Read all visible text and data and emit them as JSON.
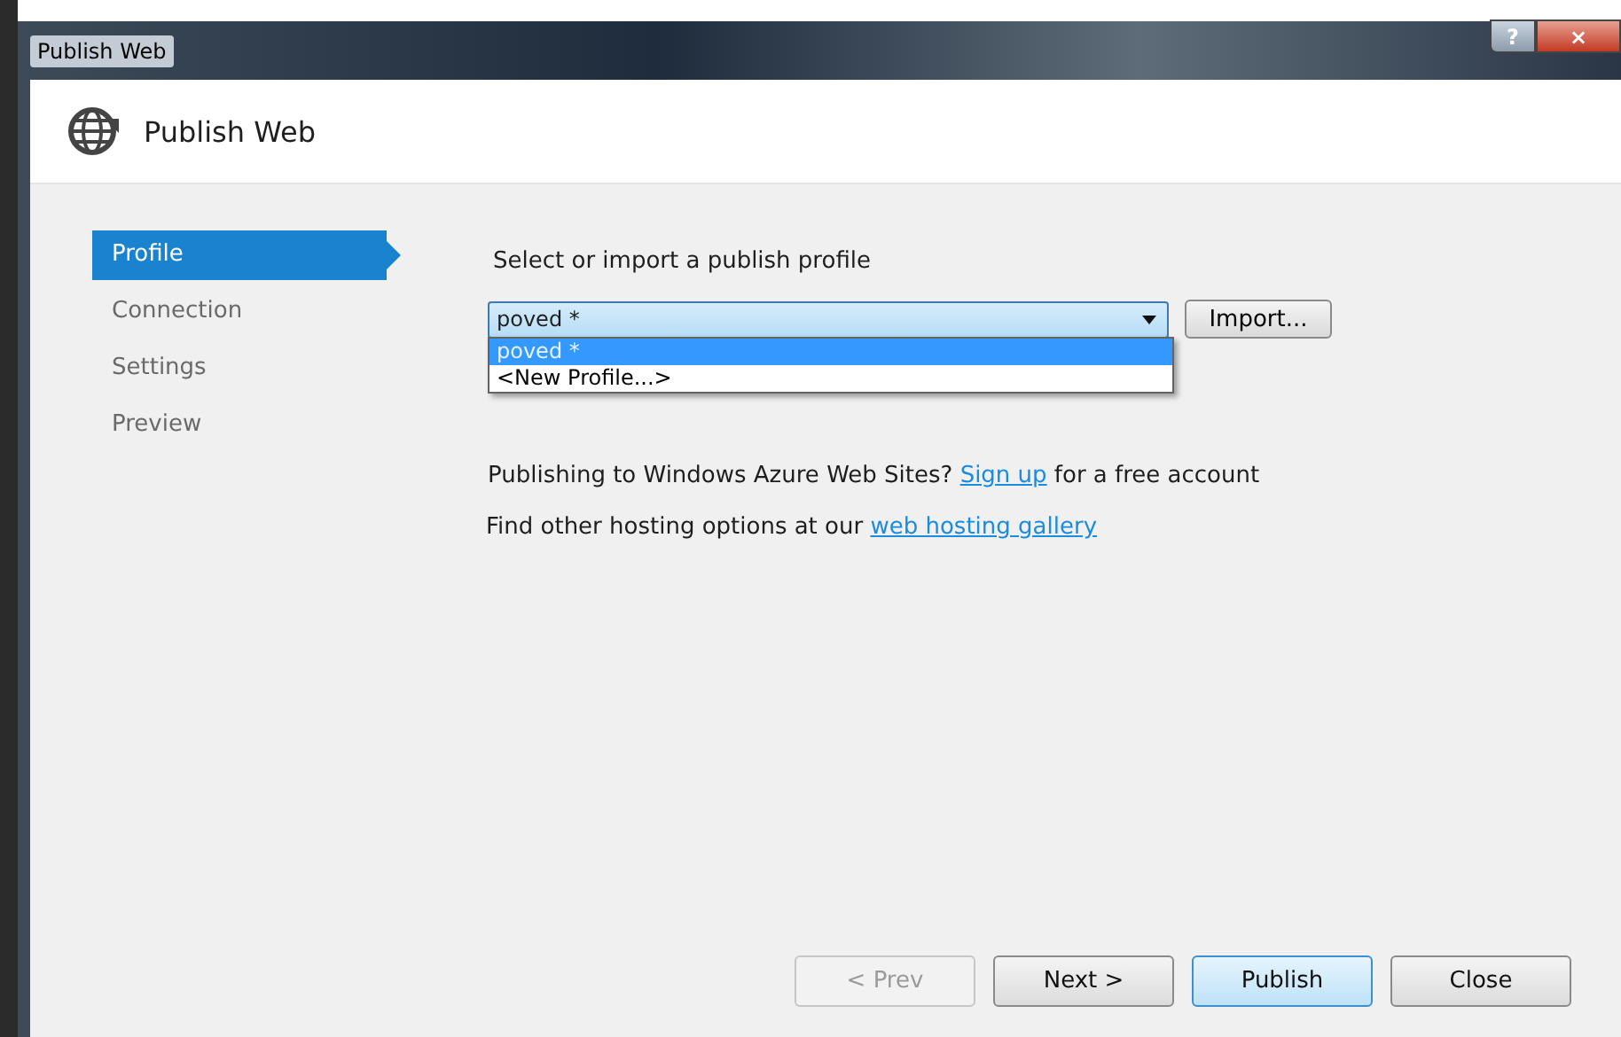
{
  "window": {
    "title": "Publish Web",
    "help": "?",
    "close": "×"
  },
  "header": {
    "title": "Publish Web"
  },
  "steps": [
    {
      "label": "Profile",
      "selected": true
    },
    {
      "label": "Connection",
      "selected": false
    },
    {
      "label": "Settings",
      "selected": false
    },
    {
      "label": "Preview",
      "selected": false
    }
  ],
  "profile": {
    "prompt": "Select or import a publish profile",
    "combo": {
      "value": "poved *",
      "expanded": true,
      "options": [
        {
          "label": "poved *",
          "selected": true
        },
        {
          "label": "<New Profile...>",
          "selected": false
        }
      ]
    },
    "import_button": "Import...",
    "azure_note": {
      "before": "Publishing to Windows Azure Web Sites? ",
      "link": "Sign up",
      "after": " for a free account"
    },
    "hosting_note": {
      "before": "Find other hosting options at our ",
      "link": "web hosting gallery"
    }
  },
  "buttons": [
    {
      "label": "< Prev",
      "disabled": true,
      "default": false
    },
    {
      "label": "Next >",
      "disabled": false,
      "default": false
    },
    {
      "label": "Publish",
      "disabled": false,
      "default": true
    },
    {
      "label": "Close",
      "disabled": false,
      "default": false
    }
  ]
}
